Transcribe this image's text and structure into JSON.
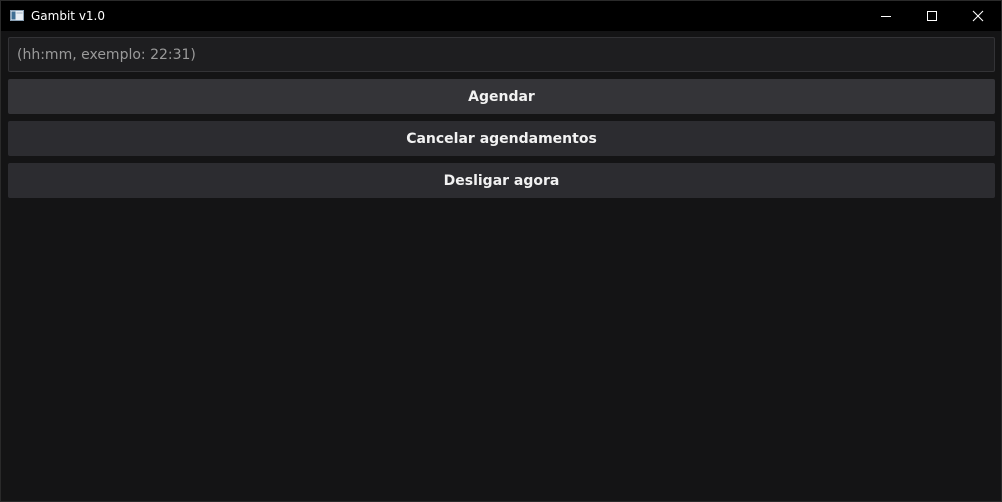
{
  "window": {
    "title": "Gambit v1.0",
    "controls": {
      "minimize": "minimize-icon",
      "maximize": "maximize-icon",
      "close": "close-icon"
    }
  },
  "form": {
    "time_placeholder": "(hh:mm, exemplo: 22:31)",
    "time_value": ""
  },
  "buttons": {
    "schedule": "Agendar",
    "cancel_schedules": "Cancelar agendamentos",
    "shutdown_now": "Desligar agora"
  },
  "colors": {
    "background": "#141415",
    "titlebar": "#000000",
    "button": "#2c2c30",
    "text": "#f2f2f2"
  }
}
